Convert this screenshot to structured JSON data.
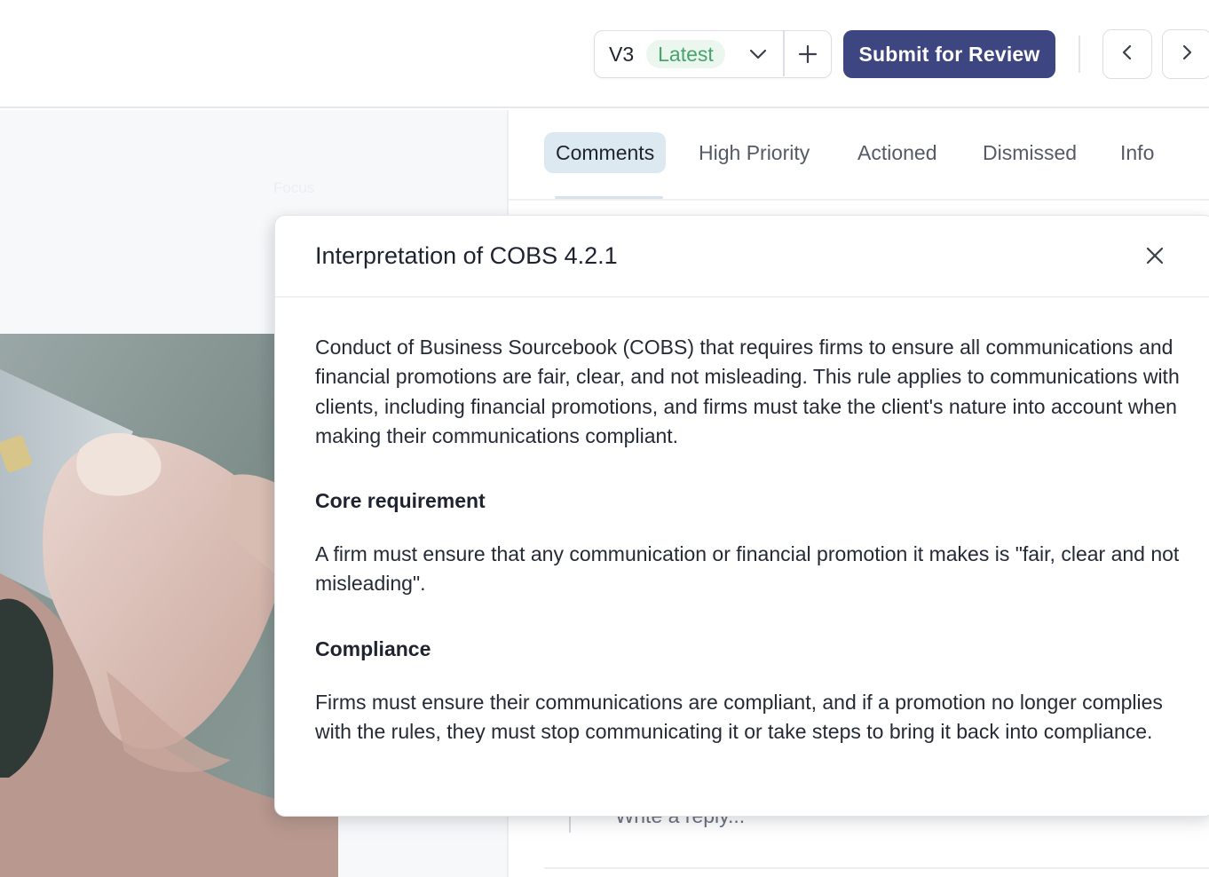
{
  "toolbar": {
    "version_label": "V3",
    "version_badge": "Latest",
    "submit_label": "Submit for Review",
    "icons": {
      "version_dropdown": "chevron-down-icon",
      "add_version": "plus-icon",
      "prev": "chevron-left-icon",
      "next": "chevron-right-icon"
    },
    "colors": {
      "submit_bg": "#3d4680",
      "badge_bg": "#eaf6ee",
      "badge_text": "#46a46c"
    }
  },
  "document": {
    "faint_label": "Focus"
  },
  "tabs": [
    {
      "label": "Comments",
      "active": true
    },
    {
      "label": "High Priority",
      "active": false
    },
    {
      "label": "Actioned",
      "active": false
    },
    {
      "label": "Dismissed",
      "active": false
    },
    {
      "label": "Info",
      "active": false
    }
  ],
  "reply": {
    "placeholder": "Write a reply..."
  },
  "modal": {
    "title": "Interpretation of COBS 4.2.1",
    "close_icon": "close-icon",
    "intro": "Conduct of Business Sourcebook (COBS) that requires firms to ensure all communications and financial promotions are fair, clear, and not misleading. This rule applies to communications with clients, including financial promotions, and firms must take the client's nature into account when making their communications compliant.",
    "sections": [
      {
        "heading": "Core requirement",
        "text": "A firm must ensure that any communication or financial promotion it makes is \"fair, clear and not misleading\"."
      },
      {
        "heading": "Compliance",
        "text": "Firms must ensure their communications are compliant, and if a promotion no longer complies with the rules, they must stop communicating it or take steps to bring it back into compliance."
      }
    ]
  }
}
